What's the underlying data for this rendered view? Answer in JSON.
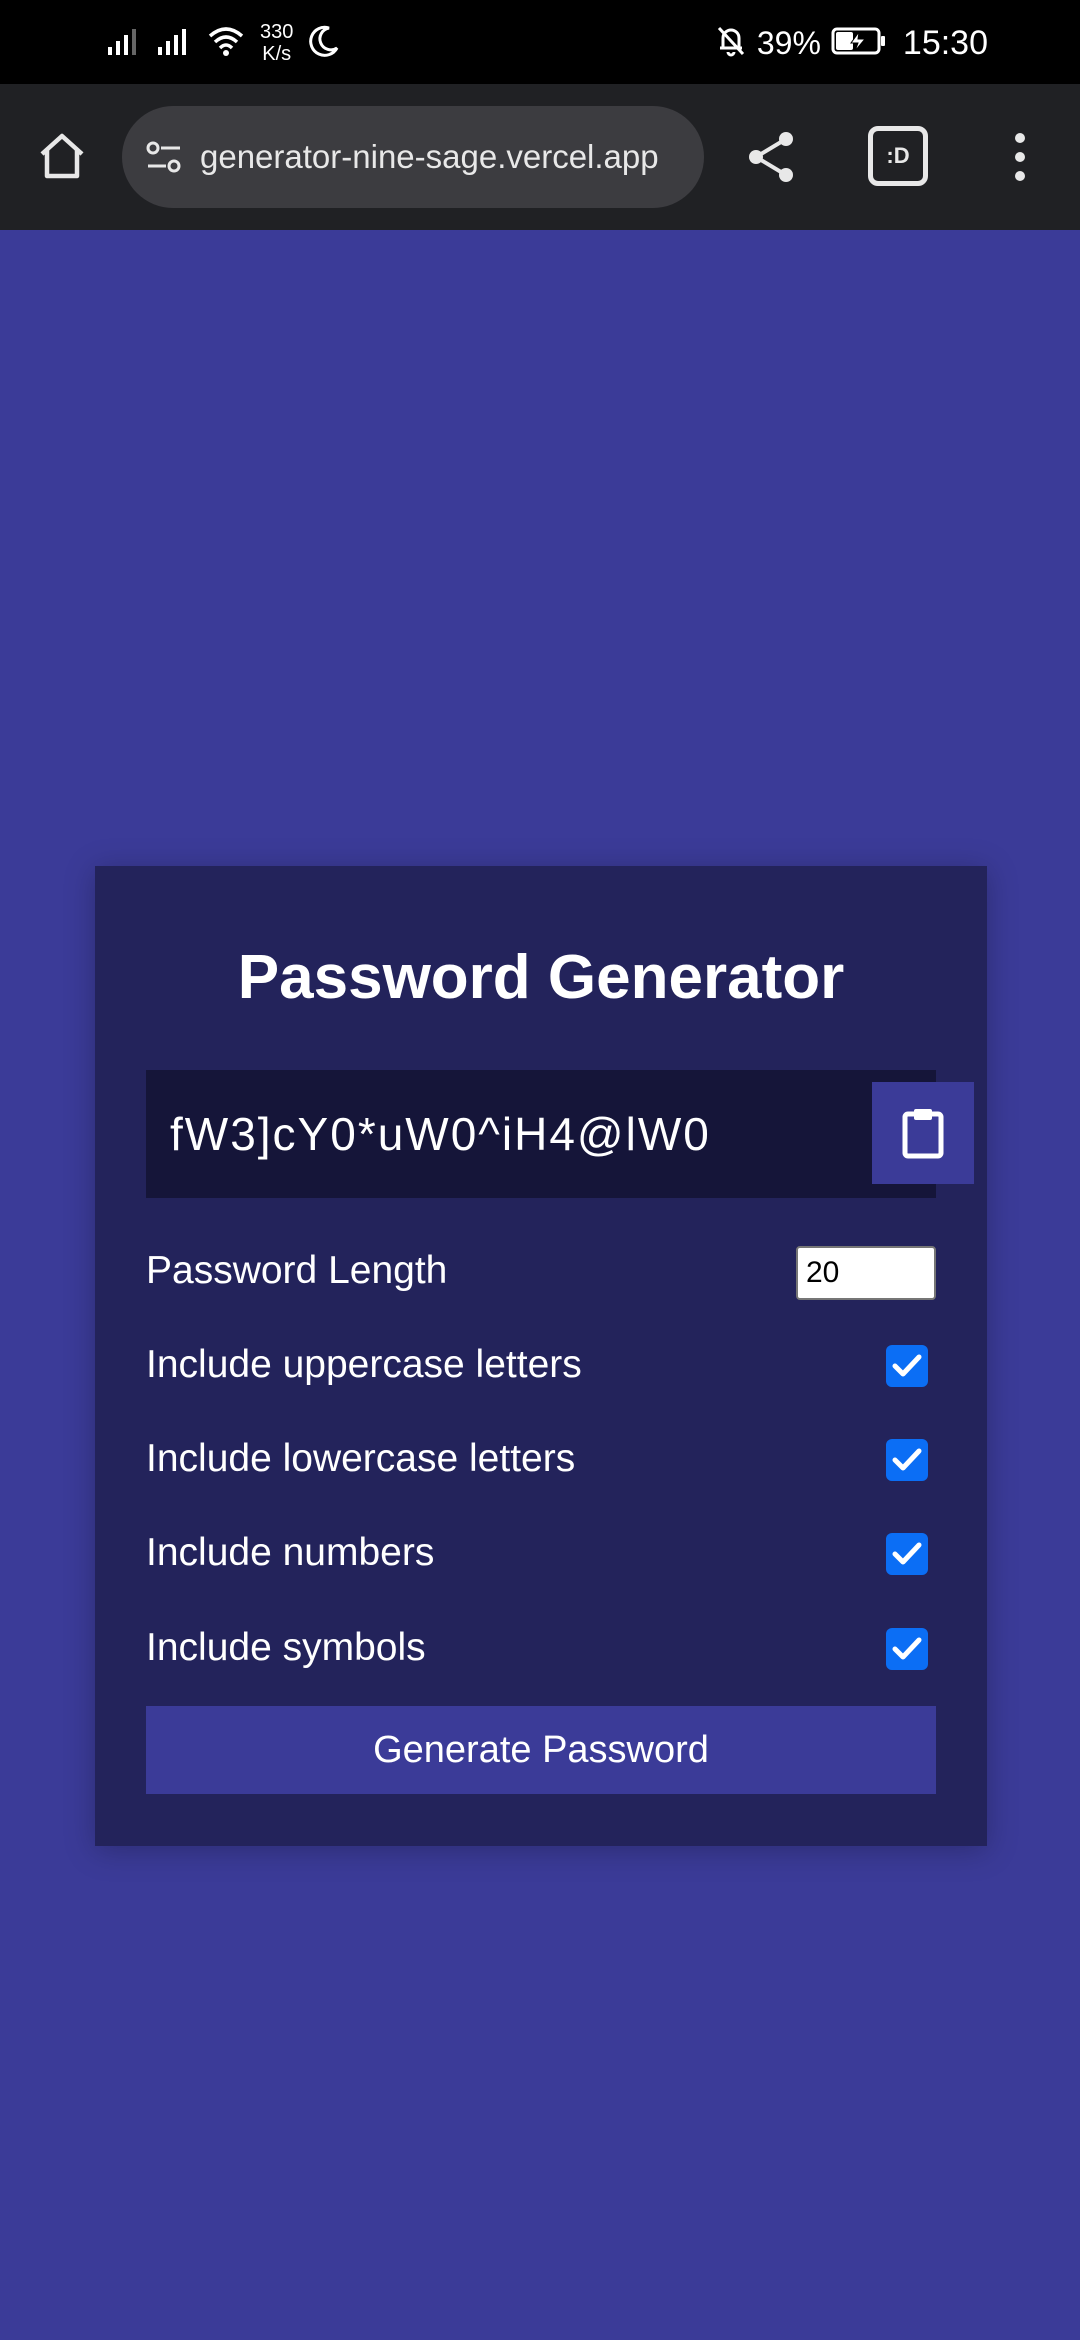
{
  "status_bar": {
    "net_speed_value": "330",
    "net_speed_unit": "K/s",
    "battery": "39%",
    "time": "15:30",
    "icons": [
      "signal-icon",
      "signal-icon",
      "wifi-icon",
      "moon-icon",
      "mute-bell-icon",
      "battery-charging-icon"
    ]
  },
  "browser": {
    "url": "generator-nine-sage.vercel.app",
    "tab_label": ":D",
    "icons": [
      "home-icon",
      "site-settings-icon",
      "share-icon",
      "tab-switcher-icon",
      "more-vert-icon"
    ]
  },
  "card": {
    "title": "Password Generator",
    "password": "fW3]cY0*uW0^iH4@lW0",
    "copy_icon": "clipboard-icon",
    "length_label": "Password Length",
    "length_value": "20",
    "options": [
      {
        "label": "Include uppercase letters",
        "checked": true
      },
      {
        "label": "Include lowercase letters",
        "checked": true
      },
      {
        "label": "Include numbers",
        "checked": true
      },
      {
        "label": "Include symbols",
        "checked": true
      }
    ],
    "generate_label": "Generate Password"
  },
  "colors": {
    "background": "#3b3b98",
    "card": "#23235b",
    "password_field": "#151539",
    "checkbox": "#0b6ef5"
  }
}
